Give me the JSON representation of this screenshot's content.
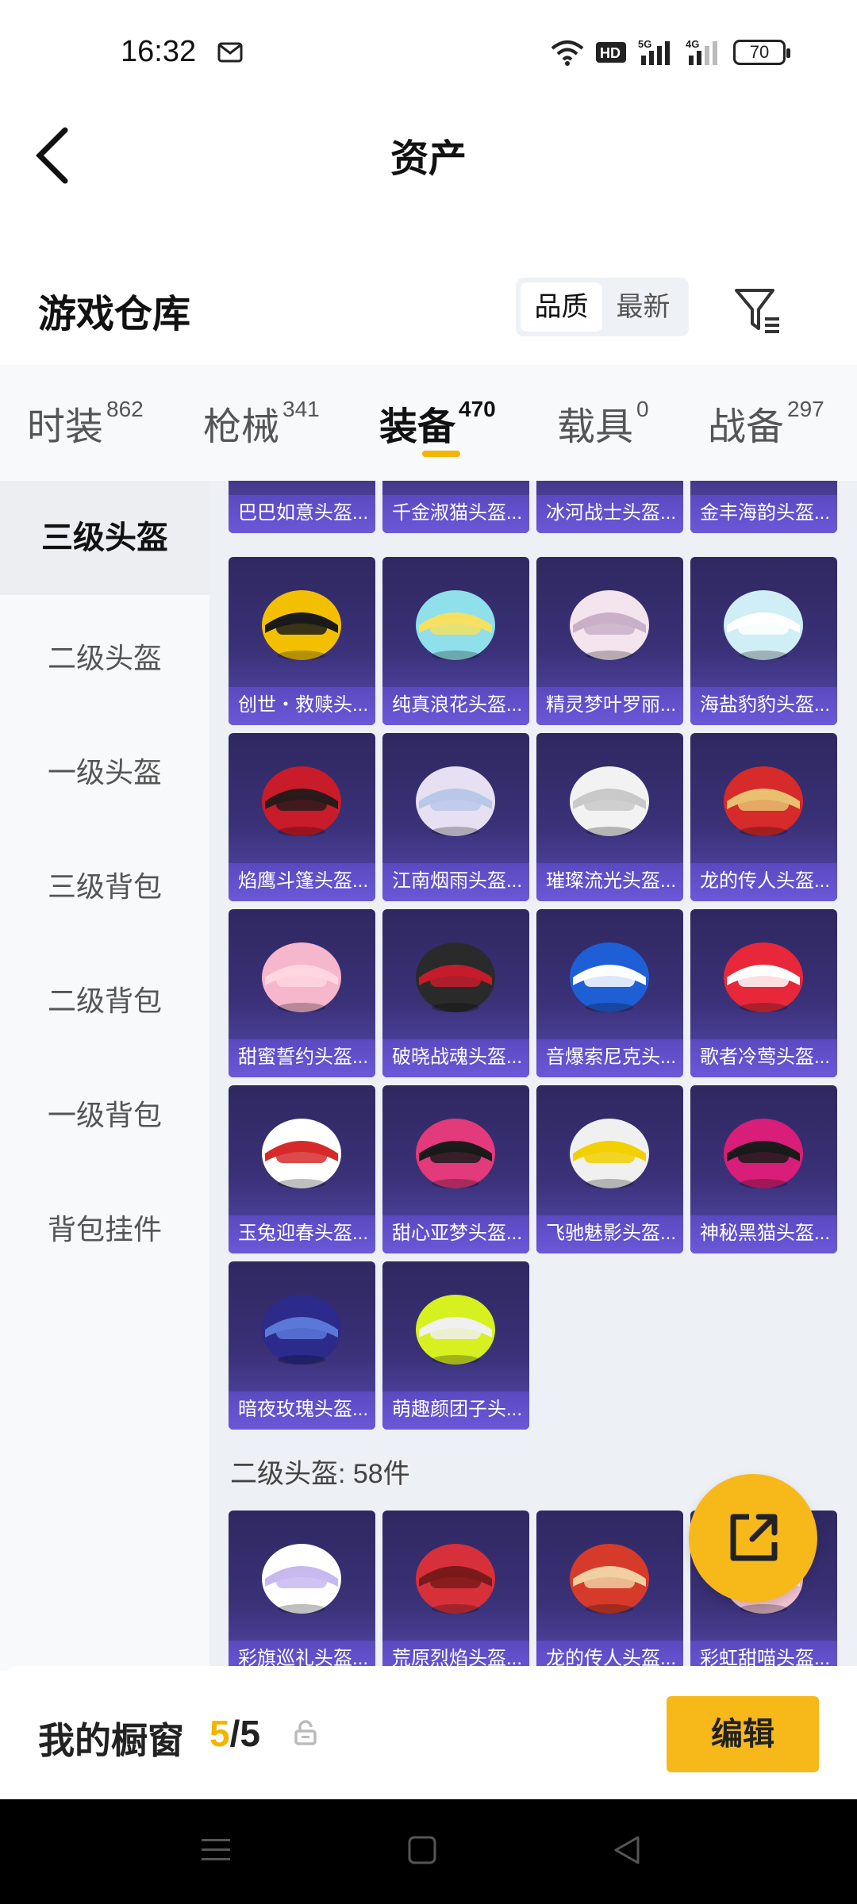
{
  "status_bar": {
    "time": "16:32",
    "battery": "70",
    "icons": [
      "mail-icon",
      "wifi-icon",
      "hd-icon",
      "signal-5g-icon",
      "signal-4g-icon",
      "battery-icon"
    ]
  },
  "header": {
    "title": "资产",
    "back_icon": "chevron-left-icon"
  },
  "warehouse": {
    "title": "游戏仓库",
    "sort_options": [
      "品质",
      "最新"
    ],
    "sort_selected": "品质",
    "filter_icon": "filter-icon"
  },
  "tabs": [
    {
      "label": "时装",
      "count": "862"
    },
    {
      "label": "枪械",
      "count": "341"
    },
    {
      "label": "装备",
      "count": "470"
    },
    {
      "label": "载具",
      "count": "0"
    },
    {
      "label": "战备",
      "count": "297"
    }
  ],
  "active_tab": "装备",
  "sidebar": {
    "items": [
      "三级头盔",
      "二级头盔",
      "一级头盔",
      "三级背包",
      "二级背包",
      "一级背包",
      "背包挂件"
    ],
    "active": "三级头盔"
  },
  "items_level3": [
    "巴巴如意头盔...",
    "千金淑猫头盔...",
    "冰河战士头盔...",
    "金丰海韵头盔...",
    "创世・救赎头...",
    "纯真浪花头盔...",
    "精灵梦叶罗丽...",
    "海盐豹豹头盔...",
    "焰鹰斗篷头盔...",
    "江南烟雨头盔...",
    "璀璨流光头盔...",
    "龙的传人头盔...",
    "甜蜜誓约头盔...",
    "破晓战魂头盔...",
    "音爆索尼克头...",
    "歌者冷莺头盔...",
    "玉兔迎春头盔...",
    "甜心亚梦头盔...",
    "飞驰魅影头盔...",
    "神秘黑猫头盔...",
    "暗夜玫瑰头盔...",
    "萌趣颜团子头..."
  ],
  "section_level2": "二级头盔: 58件",
  "items_level2": [
    "彩旗巡礼头盔...",
    "荒原烈焰头盔...",
    "龙的传人头盔...",
    "彩虹甜喵头盔..."
  ],
  "bottom": {
    "showcase_label": "我的橱窗",
    "showcase_current": "5",
    "showcase_total": "/5",
    "edit_label": "编辑"
  },
  "colors": {
    "accent": "#f7b81a",
    "card_top": "#2f2860",
    "card_bottom": "#574bb3"
  }
}
